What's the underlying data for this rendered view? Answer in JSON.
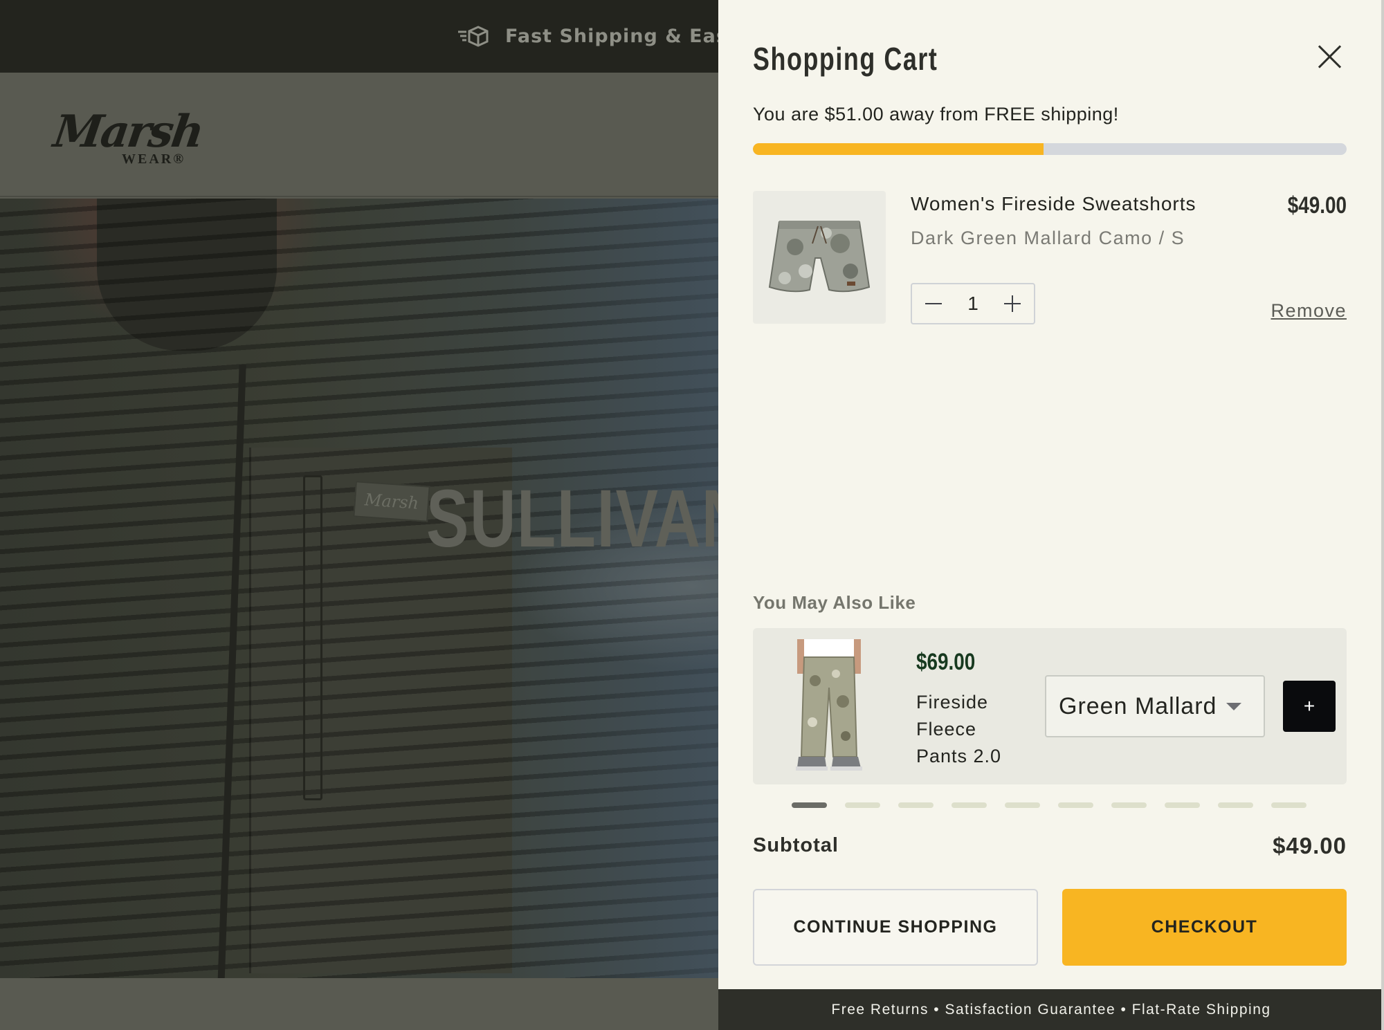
{
  "announcement": {
    "text": "Fast Shipping & Easy",
    "icon": "fast-shipping-box-icon"
  },
  "header": {
    "logo_script": "Marsh",
    "logo_sub": "WEAR®"
  },
  "hero": {
    "title": "SULLIVAN",
    "patch_text": "Marsh"
  },
  "cart": {
    "title": "Shopping Cart",
    "close_icon": "close-icon",
    "free_shipping_message": "You are $51.00 away from FREE shipping!",
    "progress_fraction": 0.49,
    "colors": {
      "accent": "#f8b522",
      "progress_track": "#d4d7dc",
      "upsell_price": "#17391f",
      "drawer_bg": "#f6f5ec"
    },
    "item": {
      "name": "Women's Fireside Sweatshorts",
      "variant": "Dark Green Mallard Camo / S",
      "price": "$49.00",
      "quantity": "1",
      "remove_label": "Remove"
    },
    "upsell": {
      "heading": "You May Also Like",
      "price": "$69.00",
      "name": "Fireside Fleece Pants 2.0",
      "selected_variant": "Green Mallard",
      "add_label": "+"
    },
    "carousel": {
      "slide_count": 10,
      "active_index": 0
    },
    "subtotal_label": "Subtotal",
    "subtotal_value": "$49.00",
    "continue_label": "CONTINUE SHOPPING",
    "checkout_label": "CHECKOUT",
    "footer_text": "Free Returns • Satisfaction Guarantee • Flat-Rate Shipping"
  }
}
